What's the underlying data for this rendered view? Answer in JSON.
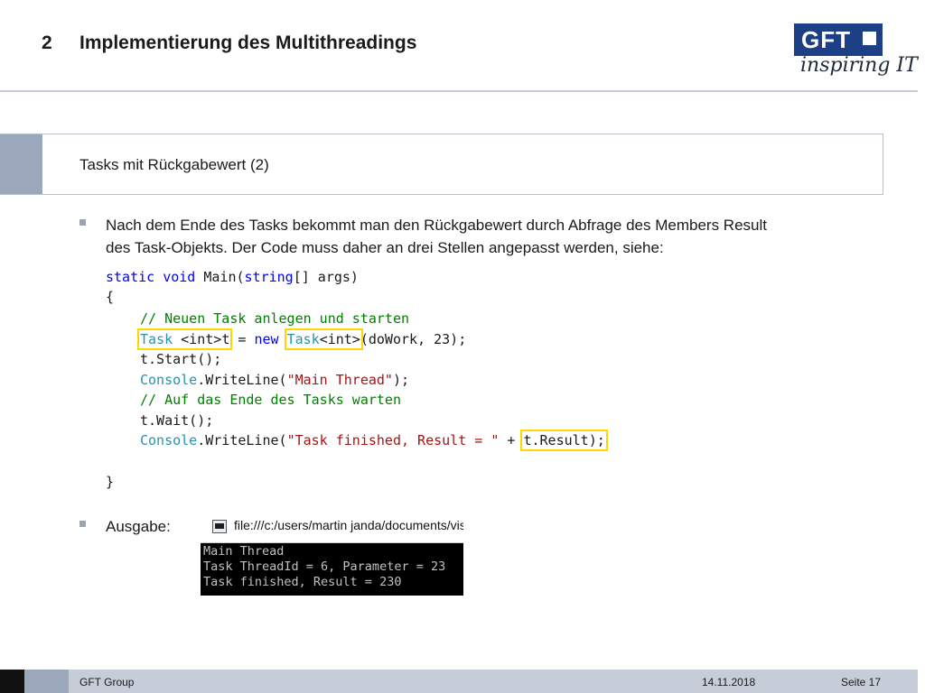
{
  "header": {
    "number": "2",
    "title": "Implementierung des Multithreadings"
  },
  "logo": {
    "text": "GFT",
    "tagline": "inspiring IT",
    "color": "#1d3f86"
  },
  "section": {
    "title": "Tasks mit Rückgabewert (2)"
  },
  "bullets": [
    {
      "lines": [
        "Nach dem Ende des Tasks bekommt man den Rückgabewert durch Abfrage des Members Result",
        "des Task-Objekts. Der Code muss daher an drei Stellen angepasst werden, siehe:"
      ]
    },
    {
      "text": "Ausgabe:"
    }
  ],
  "code": {
    "l1": {
      "kw1": "static",
      "kw2": "void",
      "name": "Main(",
      "kw3": "string",
      "rest": "[] args)"
    },
    "l2": "{",
    "l3": "// Neuen Task anlegen und starten",
    "l4": {
      "type1": "Task",
      "generic1": " <int>",
      "var": "t",
      "eq": " = ",
      "kw": "new",
      "type2": "Task",
      "generic2": "<int>",
      "rest": "(doWork, 23);"
    },
    "l5": "t.Start();",
    "l6": {
      "type": "Console",
      "method": ".WriteLine(",
      "str": "\"Main Thread\"",
      "end": ");"
    },
    "l7": "// Auf das Ende des Tasks warten",
    "l8": "t.Wait();",
    "l9": {
      "type": "Console",
      "method": ".WriteLine(",
      "str": "\"Task finished, Result = \"",
      "plus": " + ",
      "result": "t.Result);"
    },
    "l10": "}"
  },
  "console": {
    "path": "file:///c:/users/martin janda/documents/visu",
    "lines": [
      "Main Thread",
      "Task ThreadId = 6, Parameter = 23",
      "Task finished, Result = 230"
    ]
  },
  "footer": {
    "company": "GFT Group",
    "date": "14.11.2018",
    "page": "Seite 17"
  }
}
